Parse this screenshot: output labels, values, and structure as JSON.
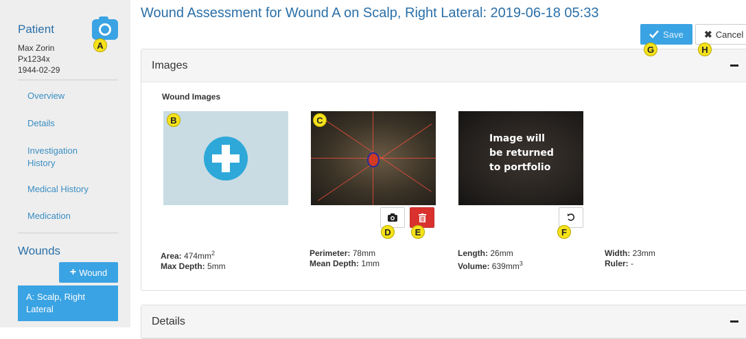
{
  "sidebar": {
    "patient_title": "Patient",
    "patient_name": "Max Zorin",
    "patient_id": "Px1234x",
    "patient_dob": "1944-02-29",
    "nav": [
      {
        "label": "Overview"
      },
      {
        "label": "Details"
      },
      {
        "label": "Investigation History"
      },
      {
        "label": "Medical History"
      },
      {
        "label": "Medication"
      }
    ],
    "wounds_title": "Wounds",
    "add_wound_label": "Wound",
    "wound_item_label": "A: Scalp, Right Lateral"
  },
  "header": {
    "title": "Wound Assessment for Wound A on Scalp, Right Lateral: 2019-06-18 05:33",
    "save_label": "Save",
    "cancel_label": "Cancel"
  },
  "images_panel": {
    "title": "Images",
    "subheading": "Wound Images",
    "overlay_text": [
      "Image will",
      "be returned",
      "to portfolio"
    ],
    "measurements": {
      "area_label": "Area:",
      "area_value": "474mm",
      "area_sup": "2",
      "max_depth_label": "Max Depth:",
      "max_depth_value": "5mm",
      "perimeter_label": "Perimeter:",
      "perimeter_value": "78mm",
      "mean_depth_label": "Mean Depth:",
      "mean_depth_value": "1mm",
      "length_label": "Length:",
      "length_value": "26mm",
      "volume_label": "Volume:",
      "volume_value": "639mm",
      "volume_sup": "3",
      "width_label": "Width:",
      "width_value": "23mm",
      "ruler_label": "Ruler:",
      "ruler_value": "-"
    }
  },
  "details_panel": {
    "title": "Details"
  },
  "markers": [
    "A",
    "B",
    "C",
    "D",
    "E",
    "F",
    "G",
    "H"
  ],
  "colors": {
    "accent": "#3aa3e3",
    "title": "#2a6fa8",
    "danger": "#d9322e",
    "marker": "#f5e21b"
  }
}
